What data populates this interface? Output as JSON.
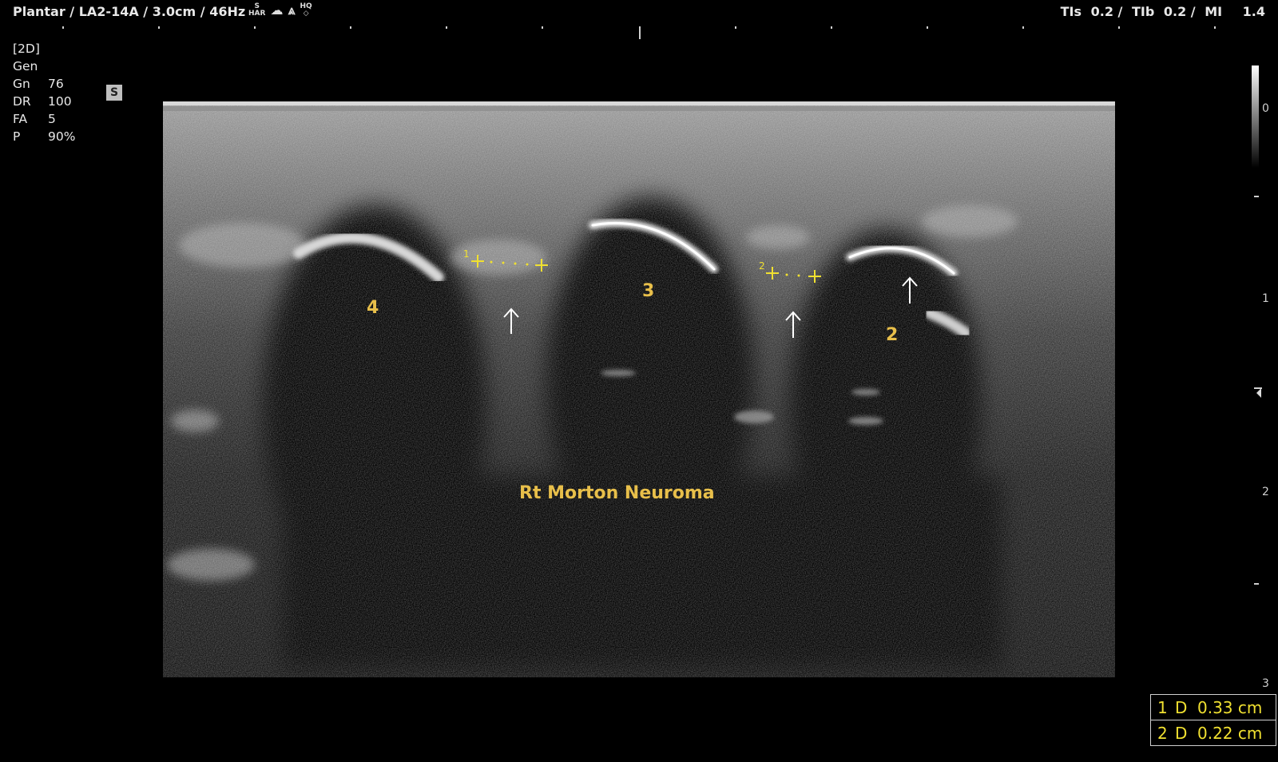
{
  "header": {
    "preset": "Plantar / LA2-14A / 3.0cm / 46Hz",
    "icons": {
      "har_top": "S",
      "har_bottom": "HAR",
      "hq_top": "HQ",
      "hq_bottom": "◇"
    },
    "tis_label": "TIs",
    "tis_value": "0.2 /",
    "tib_label": "TIb",
    "tib_value": "0.2 /",
    "mi_label": "MI",
    "mi_value": "1.4"
  },
  "params": {
    "mode": "[2D]",
    "preset": "Gen",
    "rows": [
      {
        "key": "Gn",
        "value": "76"
      },
      {
        "key": "DR",
        "value": "100"
      },
      {
        "key": "FA",
        "value": "5"
      },
      {
        "key": "P",
        "value": "90%"
      }
    ]
  },
  "badge": "S",
  "image": {
    "labels": {
      "metatarsal_4": "4",
      "metatarsal_3": "3",
      "metatarsal_2": "2"
    },
    "title": "Rt Morton Neuroma",
    "caliper_1": "1",
    "caliper_2": "2"
  },
  "depth_scale": {
    "marks": [
      "0",
      "1",
      "2",
      "3"
    ]
  },
  "measurements": [
    {
      "index": "1",
      "type": "D",
      "value": "0.33 cm"
    },
    {
      "index": "2",
      "type": "D",
      "value": "0.22 cm"
    }
  ],
  "colors": {
    "annotation": "#e8bf4a",
    "caliper": "#f0e030"
  }
}
